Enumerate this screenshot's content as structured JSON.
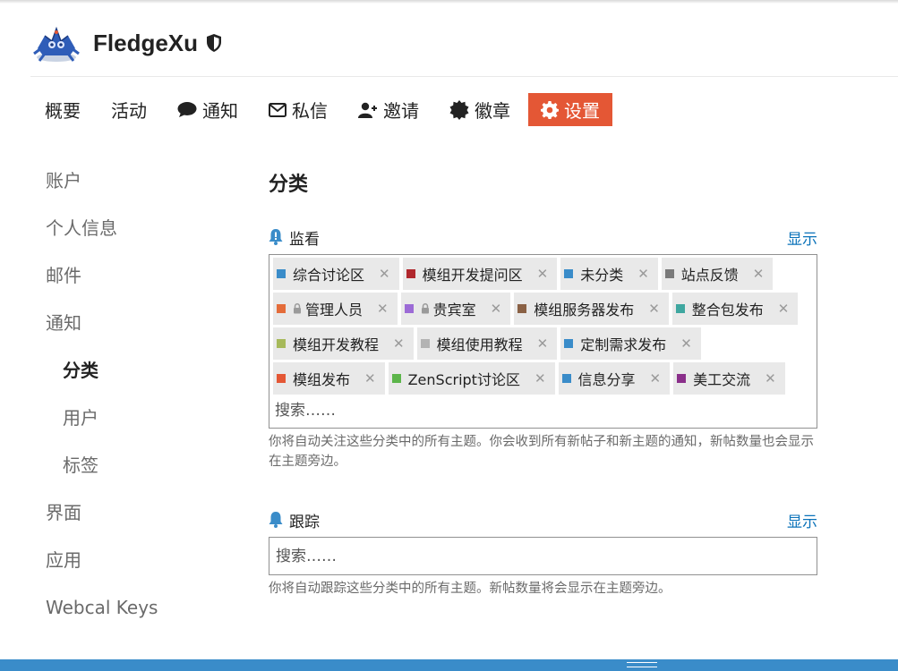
{
  "user": {
    "name": "FledgeXu"
  },
  "nav": [
    {
      "id": "summary",
      "label": "概要",
      "icon": ""
    },
    {
      "id": "activity",
      "label": "活动",
      "icon": ""
    },
    {
      "id": "notifications",
      "label": "通知",
      "icon": "comment-icon"
    },
    {
      "id": "messages",
      "label": "私信",
      "icon": "envelope-icon"
    },
    {
      "id": "invites",
      "label": "邀请",
      "icon": "user-plus-icon"
    },
    {
      "id": "badges",
      "label": "徽章",
      "icon": "certificate-icon"
    },
    {
      "id": "preferences",
      "label": "设置",
      "icon": "gear-icon",
      "active": true
    }
  ],
  "sidebar": [
    {
      "label": "账户",
      "sub": false
    },
    {
      "label": "个人信息",
      "sub": false
    },
    {
      "label": "邮件",
      "sub": false
    },
    {
      "label": "通知",
      "sub": false
    },
    {
      "label": "分类",
      "sub": true,
      "current": true
    },
    {
      "label": "用户",
      "sub": true
    },
    {
      "label": "标签",
      "sub": true
    },
    {
      "label": "界面",
      "sub": false
    },
    {
      "label": "应用",
      "sub": false
    },
    {
      "label": "Webcal Keys",
      "sub": false
    }
  ],
  "main": {
    "title": "分类",
    "watched": {
      "label": "监看",
      "show": "显示",
      "categories": [
        {
          "name": "综合讨论区",
          "color": "#3a8cc9",
          "locked": false
        },
        {
          "name": "模组开发提问区",
          "color": "#b0282d",
          "locked": false
        },
        {
          "name": "未分类",
          "color": "#3a8cc9",
          "locked": false
        },
        {
          "name": "站点反馈",
          "color": "#7a7a7a",
          "locked": false
        },
        {
          "name": "管理人员",
          "color": "#e46c3a",
          "locked": true
        },
        {
          "name": "贵宾室",
          "color": "#9c6bd6",
          "locked": true
        },
        {
          "name": "模组服务器发布",
          "color": "#8a6145",
          "locked": false
        },
        {
          "name": "整合包发布",
          "color": "#3fa7a0",
          "locked": false
        },
        {
          "name": "模组开发教程",
          "color": "#a6b95a",
          "locked": false
        },
        {
          "name": "模组使用教程",
          "color": "#b3b3b3",
          "locked": false
        },
        {
          "name": "定制需求发布",
          "color": "#3a8cc9",
          "locked": false
        },
        {
          "name": "模组发布",
          "color": "#e45735",
          "locked": false
        },
        {
          "name": "ZenScript讨论区",
          "color": "#5cb54a",
          "locked": false
        },
        {
          "name": "信息分享",
          "color": "#3a8cc9",
          "locked": false
        },
        {
          "name": "美工交流",
          "color": "#8a2f8a",
          "locked": false
        }
      ],
      "search_placeholder": "搜索……",
      "help": "你将自动关注这些分类中的所有主题。你会收到所有新帖子和新主题的通知，新帖数量也会显示在主题旁边。"
    },
    "tracked": {
      "label": "跟踪",
      "show": "显示",
      "search_placeholder": "搜索……",
      "help": "你将自动跟踪这些分类中的所有主题。新帖数量将会显示在主题旁边。"
    }
  },
  "colors": {
    "accent": "#e45735",
    "link": "#0a72b9",
    "bottom_bar": "#3a8cc9"
  }
}
